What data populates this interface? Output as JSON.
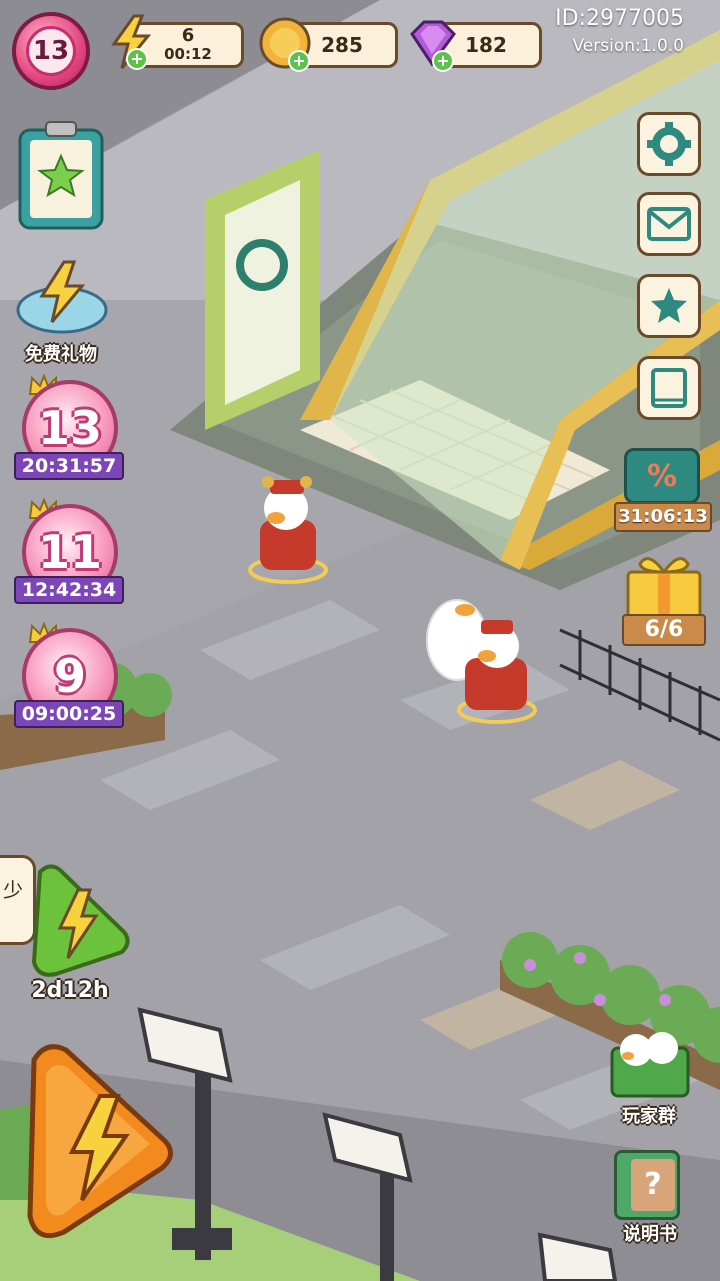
{
  "hud": {
    "level": "13",
    "energy": {
      "value": "6",
      "timer": "00:12",
      "icon": "lightning-icon"
    },
    "coins": {
      "value": "285",
      "icon": "coin-icon"
    },
    "gems": {
      "value": "182",
      "icon": "gem-icon"
    },
    "player_id": "ID:2977005",
    "version": "Version:1.0.0"
  },
  "left_panel": {
    "free_gift_label": "免费礼物",
    "events": [
      {
        "level": "13",
        "timer": "20:31:57"
      },
      {
        "level": "11",
        "timer": "12:42:34"
      },
      {
        "level": "9",
        "timer": "09:00:25"
      }
    ],
    "partial_label": "少",
    "boost_timer": "2d12h"
  },
  "right_panel": {
    "settings_icon": "gear-icon",
    "mail_icon": "mail-icon",
    "achievement_icon": "ribbon-star-icon",
    "book_icon": "book-icon",
    "sale_timer": "31:06:13",
    "sale_symbol": "%",
    "gift_count": "6/6",
    "player_group_label": "玩家群",
    "manual_label": "说明书",
    "manual_symbol": "?"
  },
  "colors": {
    "road": "#9c9ca2",
    "sidewalk": "#b8b8be",
    "accent_pink": "#e4467f",
    "panel_cream": "#fbf1da",
    "panel_border": "#6b4a2c",
    "timer_purple": "#7c46b8",
    "energy_green": "#6cc23a",
    "energy_orange": "#f28a1e"
  }
}
